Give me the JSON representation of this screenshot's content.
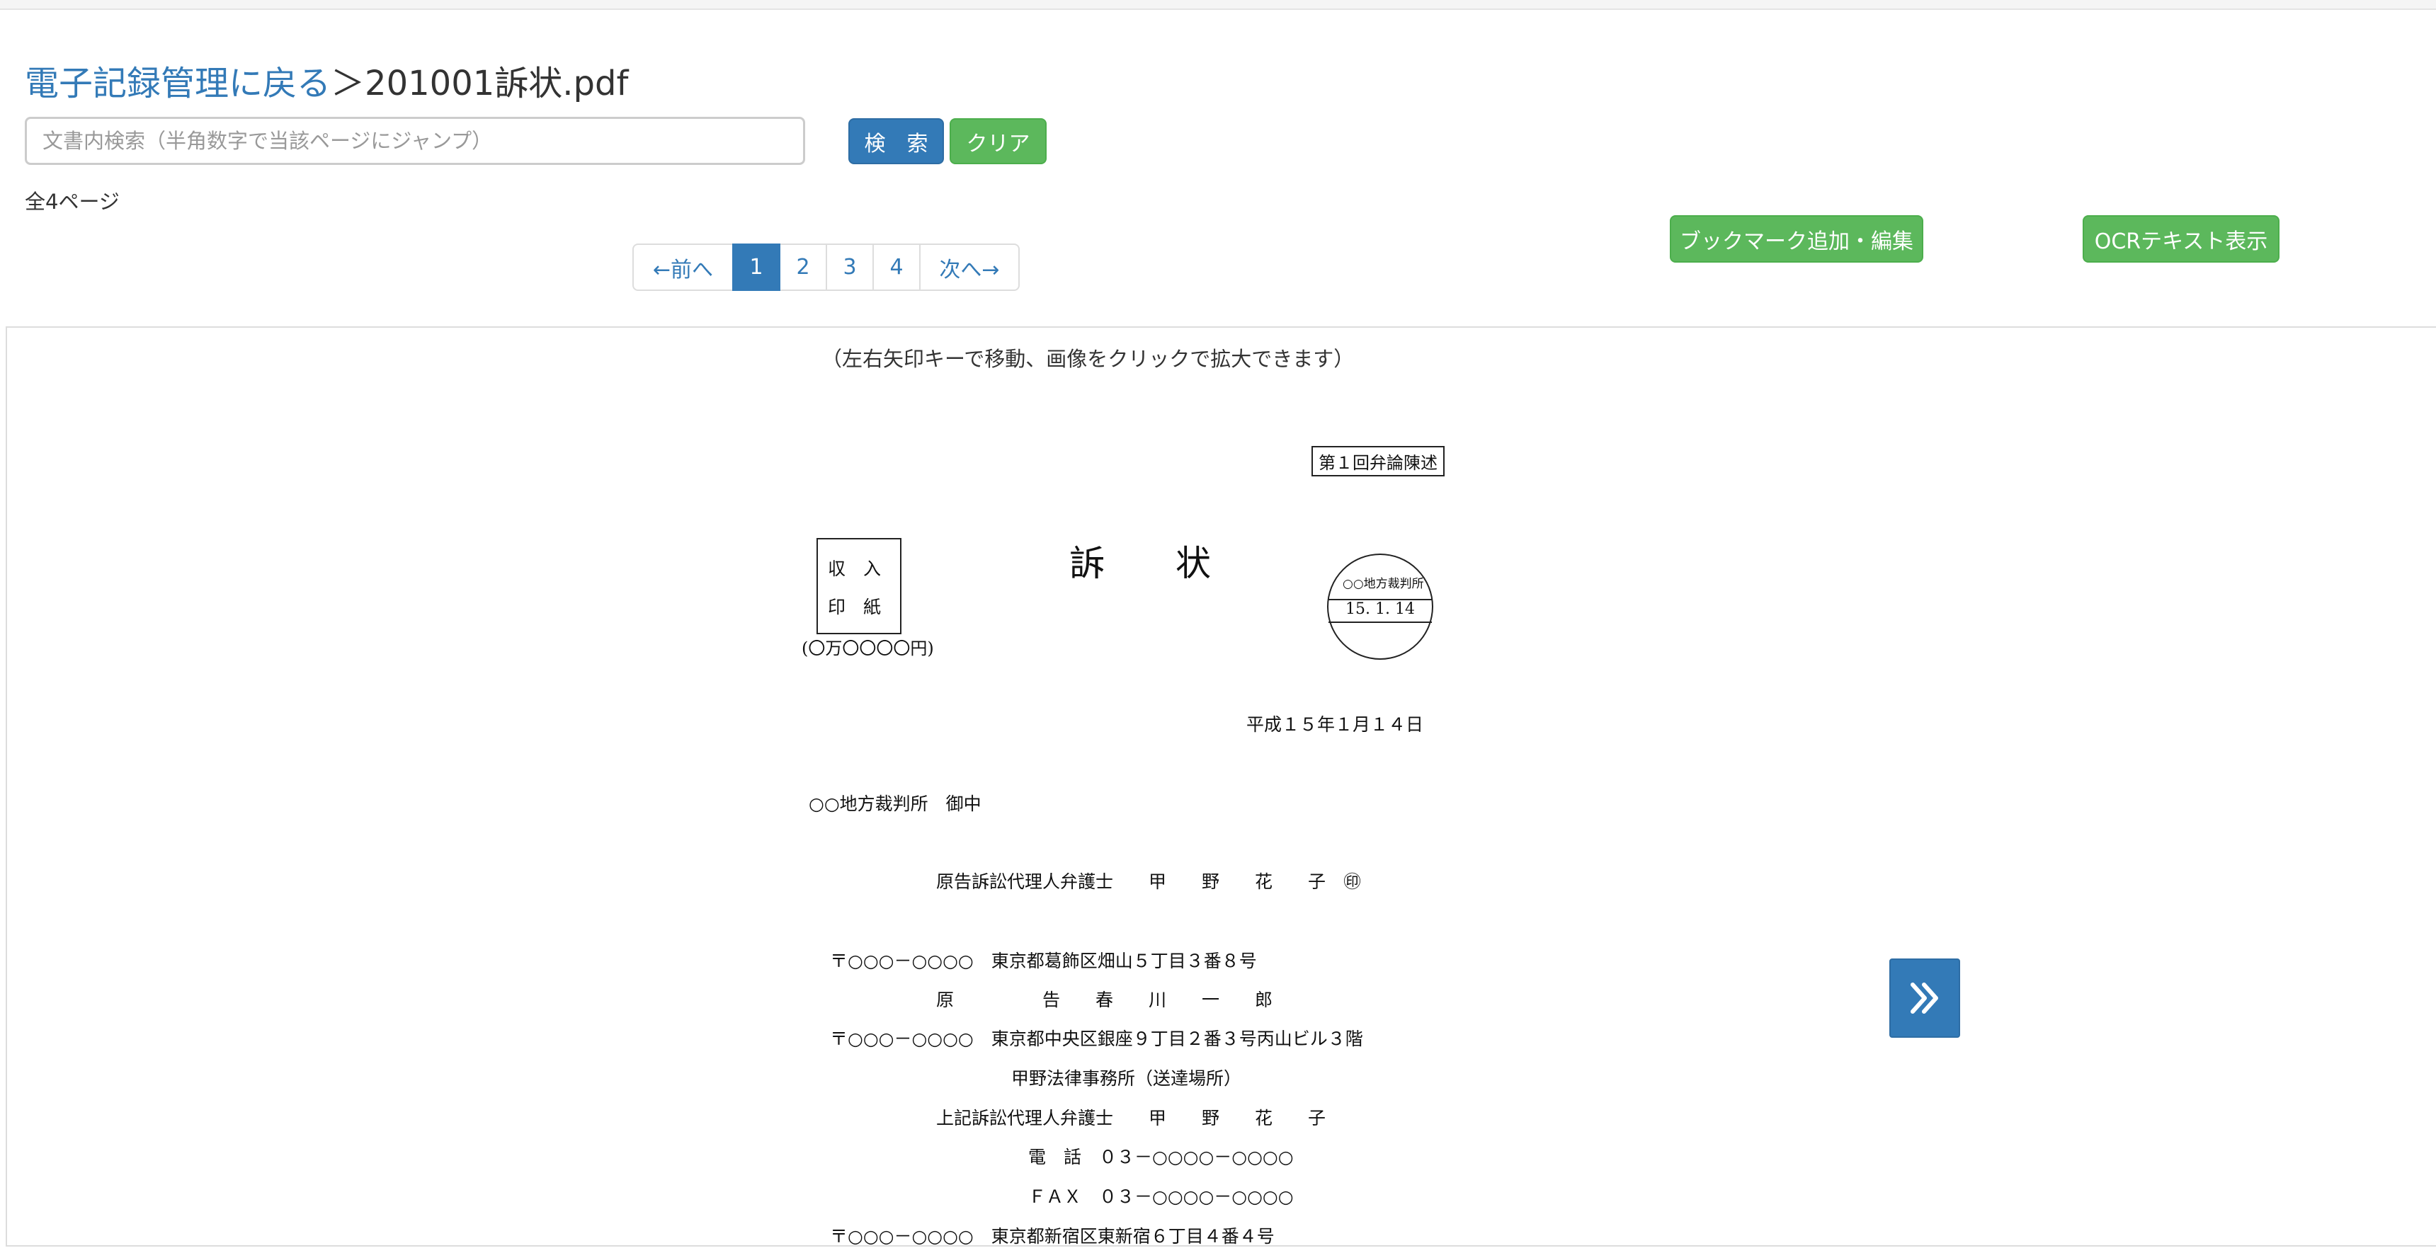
{
  "breadcrumb": {
    "back_link": "電子記録管理に戻る",
    "separator": "＞",
    "filename": "201001訴状.pdf"
  },
  "search": {
    "placeholder": "文書内検索（半角数字で当該ページにジャンプ）",
    "value": "",
    "search_label": "検　索",
    "clear_label": "クリア"
  },
  "page_count": "全4ページ",
  "pagination": {
    "prev": "←前へ",
    "pages": [
      "1",
      "2",
      "3",
      "4"
    ],
    "current": "1",
    "next": "次へ→"
  },
  "actions": {
    "bookmark_label": "ブックマーク追加・編集",
    "ocr_label": "OCRテキスト表示"
  },
  "viewer": {
    "hint": "（左右矢印キーで移動、画像をクリックで拡大できます）",
    "next_icon": "double-chevron-right-icon"
  },
  "document": {
    "first_hearing": "第１回弁論陳述",
    "stamp_line1": "収　入",
    "stamp_line2": "印　紙",
    "stamp_amount": "(〇万〇〇〇〇円)",
    "title": "訴　　状",
    "court_seal_name": "○○地方裁判所",
    "court_seal_date": "15. 1. 14",
    "date": "平成１５年１月１４日",
    "addressee": "○○地方裁判所　御中",
    "attorney_line": "原告訴訟代理人弁護士　　甲　　野　　花　　子　㊞",
    "plaintiff_postal_address": "〒○○○－○○○○　東京都葛飾区畑山５丁目３番８号",
    "plaintiff_name": "原　　　　　告　　春　　川　　一　　郎",
    "office_postal_address": "〒○○○－○○○○　東京都中央区銀座９丁目２番３号丙山ビル３階",
    "office_name": "甲野法律事務所（送達場所）",
    "attorney_line2": "上記訴訟代理人弁護士　　甲　　野　　花　　子",
    "phone": "電　話　０３－○○○○－○○○○",
    "fax": "ＦＡＸ　０３－○○○○－○○○○",
    "defendant_postal_address": "〒○○○－○○○○　東京都新宿区東新宿６丁目４番４号"
  }
}
